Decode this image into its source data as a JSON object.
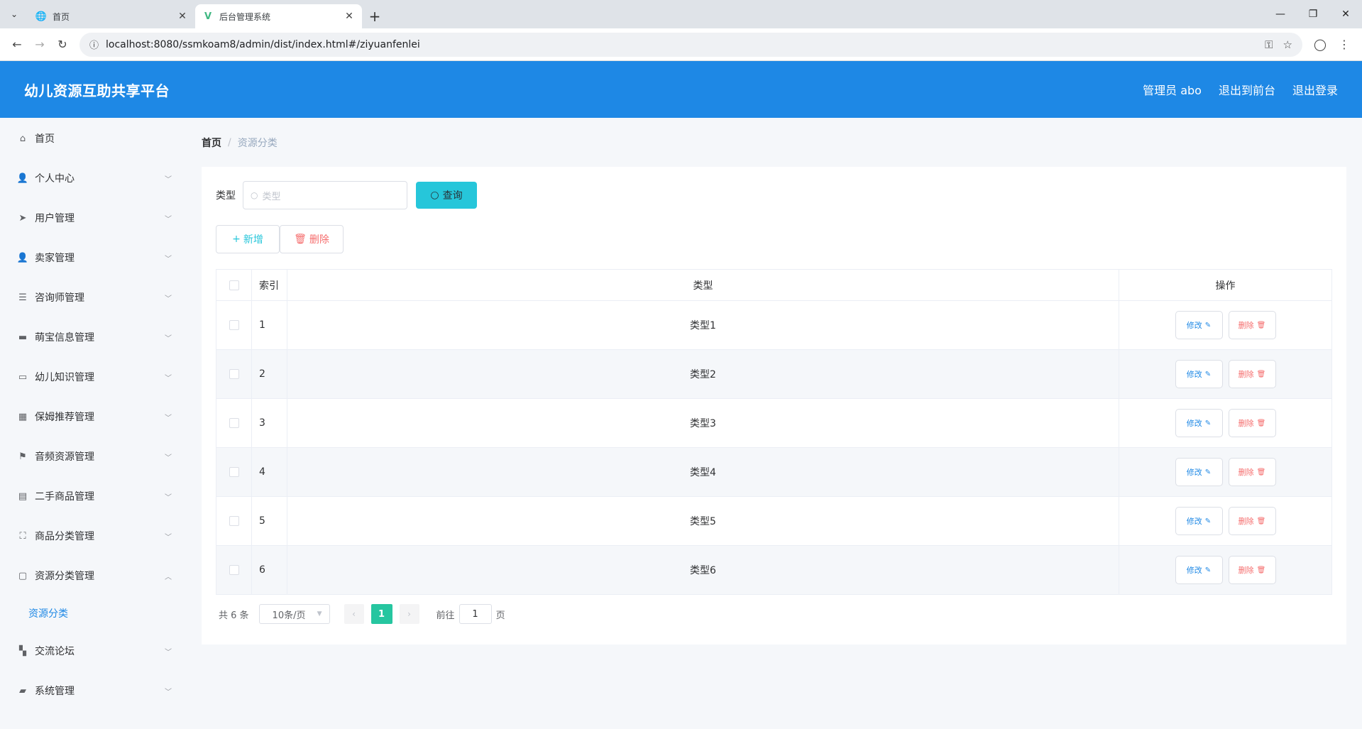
{
  "browser": {
    "tabs": [
      {
        "title": "首页",
        "icon": "globe-icon"
      },
      {
        "title": "后台管理系统",
        "icon": "vue-icon"
      }
    ],
    "url": "localhost:8080/ssmkoam8/admin/dist/index.html#/ziyuanfenlei"
  },
  "header": {
    "brand": "幼儿资源互助共享平台",
    "user": "管理员 abo",
    "to_front": "退出到前台",
    "logout": "退出登录",
    "bg_color": "#1e88e5"
  },
  "sidebar": {
    "items": [
      {
        "label": "首页",
        "icon": "home-icon",
        "expandable": false
      },
      {
        "label": "个人中心",
        "icon": "user-icon",
        "expandable": true
      },
      {
        "label": "用户管理",
        "icon": "send-icon",
        "expandable": true
      },
      {
        "label": "卖家管理",
        "icon": "user-icon",
        "expandable": true
      },
      {
        "label": "咨询师管理",
        "icon": "list-icon",
        "expandable": true
      },
      {
        "label": "萌宝信息管理",
        "icon": "message-icon",
        "expandable": true
      },
      {
        "label": "幼儿知识管理",
        "icon": "monitor-icon",
        "expandable": true
      },
      {
        "label": "保姆推荐管理",
        "icon": "grid-icon",
        "expandable": true
      },
      {
        "label": "音频资源管理",
        "icon": "flag-icon",
        "expandable": true
      },
      {
        "label": "二手商品管理",
        "icon": "clipboard-icon",
        "expandable": true
      },
      {
        "label": "商品分类管理",
        "icon": "fullscreen-icon",
        "expandable": true
      },
      {
        "label": "资源分类管理",
        "icon": "chat-icon",
        "expandable": true,
        "open": true
      },
      {
        "label": "交流论坛",
        "icon": "apps-icon",
        "expandable": true
      },
      {
        "label": "系统管理",
        "icon": "wallet-icon",
        "expandable": true
      }
    ],
    "active_sub": "资源分类"
  },
  "breadcrumb": {
    "home": "首页",
    "sep": "/",
    "current": "资源分类"
  },
  "search": {
    "label": "类型",
    "placeholder": "类型",
    "button": "查询"
  },
  "actions": {
    "add": "新增",
    "delete": "删除"
  },
  "table": {
    "headers": {
      "index": "索引",
      "type": "类型",
      "op": "操作"
    },
    "edit_label": "修改",
    "delete_label": "删除",
    "rows": [
      {
        "index": "1",
        "type": "类型1"
      },
      {
        "index": "2",
        "type": "类型2"
      },
      {
        "index": "3",
        "type": "类型3"
      },
      {
        "index": "4",
        "type": "类型4"
      },
      {
        "index": "5",
        "type": "类型5"
      },
      {
        "index": "6",
        "type": "类型6"
      }
    ]
  },
  "pagination": {
    "total": "共 6 条",
    "page_size": "10条/页",
    "current_page": "1",
    "goto_label": "前往",
    "goto_value": "1",
    "page_suffix": "页"
  }
}
